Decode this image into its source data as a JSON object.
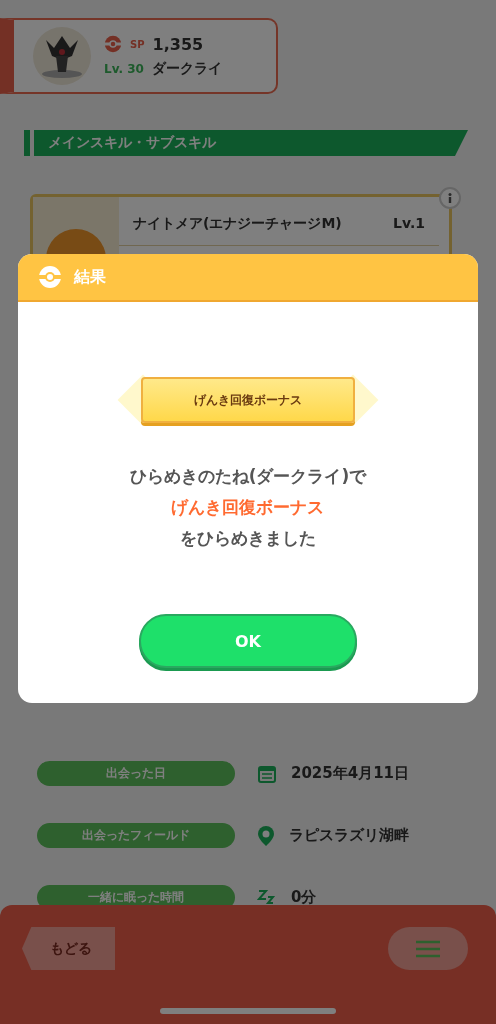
{
  "pokemon_card": {
    "sp_label": "SP",
    "sp": "1,355",
    "level": "Lv. 30",
    "name": "ダークライ"
  },
  "section_title": "メインスキル・サブスキル",
  "skill_card": {
    "name": "ナイトメア(エナジーチャージM)",
    "level": "Lv.1"
  },
  "info_rows": [
    {
      "kind": "date",
      "label": "出会った日",
      "value": "2025年4月11日"
    },
    {
      "kind": "field",
      "label": "出会ったフィールド",
      "value": "ラピスラズリ湖畔"
    },
    {
      "kind": "sleep",
      "label": "一緒に眠った時間",
      "value": "0分"
    }
  ],
  "bottom_bar": {
    "back": "もどる"
  },
  "dialog": {
    "title": "結果",
    "banner": "げんき回復ボーナス",
    "message": [
      {
        "kind": "plain",
        "text": "ひらめきのたね(ダークライ)で"
      },
      {
        "kind": "highlight",
        "text": "げんき回復ボーナス"
      },
      {
        "kind": "plain",
        "text": "をひらめきました"
      }
    ],
    "ok": "OK"
  }
}
